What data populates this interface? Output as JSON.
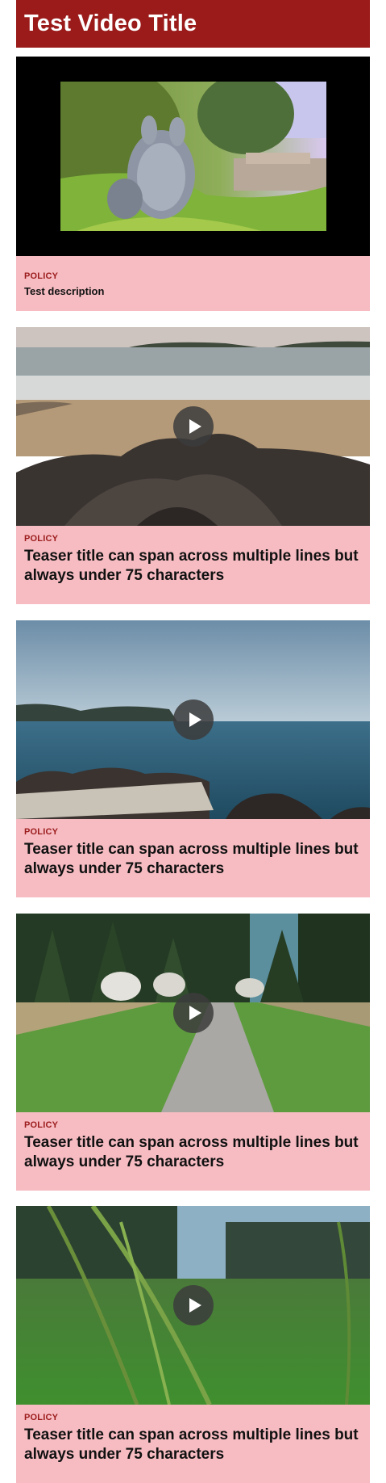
{
  "page": {
    "title": "Test Video Title"
  },
  "featured": {
    "category": "POLICY",
    "description": "Test description",
    "image": "cartoon-rabbit-video-still"
  },
  "teasers": [
    {
      "category": "POLICY",
      "title": "Teaser title can span across multiple lines but always under 75 characters",
      "image": "rocky-beach"
    },
    {
      "category": "POLICY",
      "title": "Teaser title can span across multiple lines but always under 75 characters",
      "image": "lake-shore"
    },
    {
      "category": "POLICY",
      "title": "Teaser title can span across multiple lines but always under 75 characters",
      "image": "forest-path"
    },
    {
      "category": "POLICY",
      "title": "Teaser title can span across multiple lines but always under 75 characters",
      "image": "grass-field"
    }
  ],
  "icons": {
    "play": "play-icon"
  },
  "colors": {
    "header": "#9b1b1b",
    "card_bg": "#f6bcc2",
    "category": "#9b1b1b"
  }
}
